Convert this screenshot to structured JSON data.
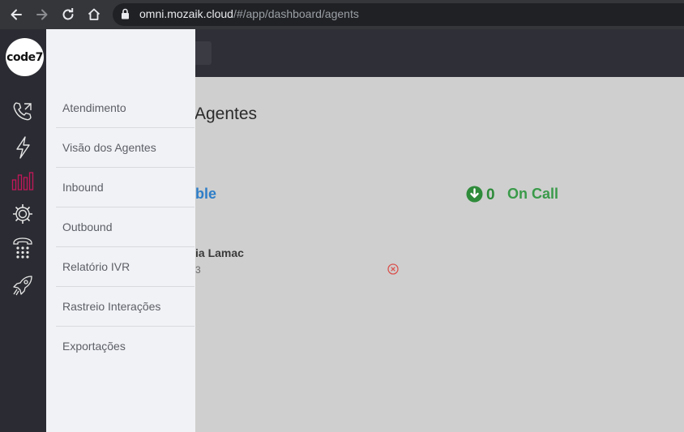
{
  "browser": {
    "url_host": "omni.mozaik.cloud",
    "url_path": "/#/app/dashboard/agents"
  },
  "logo": {
    "text": "code7"
  },
  "rail": {
    "icons": [
      "phone-forward-icon",
      "lightning-icon",
      "bar-chart-icon",
      "gear-icon",
      "dialpad-phone-icon",
      "rocket-icon"
    ],
    "active_color": "#c2185b"
  },
  "submenu": {
    "items": [
      {
        "label": "Atendimento"
      },
      {
        "label": "Visão dos Agentes"
      },
      {
        "label": "Inbound"
      },
      {
        "label": "Outbound"
      },
      {
        "label": "Relatório IVR"
      },
      {
        "label": "Rastreio Interações"
      },
      {
        "label": "Exportações"
      }
    ]
  },
  "main": {
    "title_partial": "Agentes",
    "available_partial": "ble",
    "on_call": {
      "count": "0",
      "label": "On Call"
    },
    "agent": {
      "name_partial": "ia Lamac",
      "ext_partial": "3"
    }
  },
  "colors": {
    "available": "#2e7ec8",
    "on_call": "#3a9a4a",
    "remove": "#d9534f"
  }
}
